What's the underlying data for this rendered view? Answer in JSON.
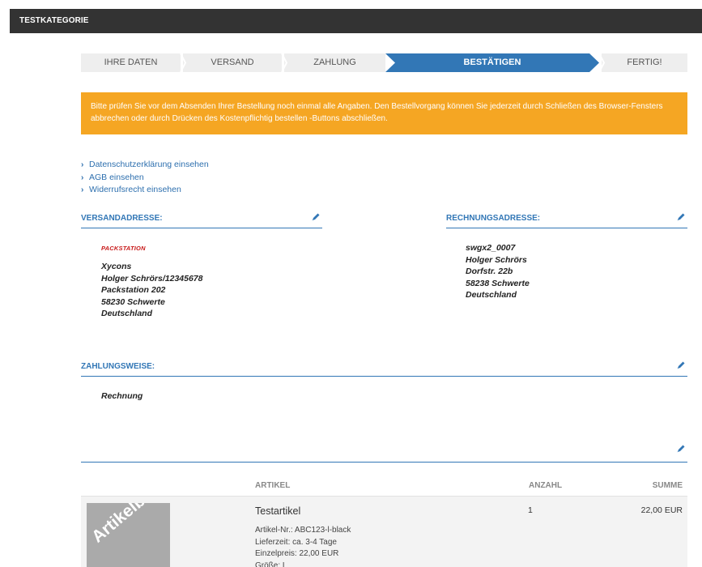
{
  "header": {
    "category": "TESTKATEGORIE"
  },
  "steps": [
    {
      "label": "IHRE DATEN",
      "active": false
    },
    {
      "label": "VERSAND",
      "active": false
    },
    {
      "label": "ZAHLUNG",
      "active": false
    },
    {
      "label": "BESTÄTIGEN",
      "active": true
    },
    {
      "label": "FERTIG!",
      "active": false
    }
  ],
  "notice": {
    "text": "Bitte prüfen Sie vor dem Absenden Ihrer Bestellung noch einmal alle Angaben. Den Bestellvorgang können Sie jederzeit durch Schließen des Browser-Fensters abbrechen oder durch Drücken des Kostenpflichtig bestellen -Buttons abschließen."
  },
  "links": [
    "Datenschutzerklärung einsehen",
    "AGB einsehen",
    "Widerrufsrecht einsehen"
  ],
  "shipping": {
    "title": "VERSANDADRESSE:",
    "brand": "PACKSTATION",
    "lines": [
      "Xycons",
      "Holger Schrörs/12345678",
      "Packstation 202",
      "58230 Schwerte",
      "Deutschland"
    ]
  },
  "billing": {
    "title": "RECHNUNGSADRESSE:",
    "lines": [
      "swgx2_0007",
      "Holger Schrörs",
      "Dorfstr. 22b",
      "58238 Schwerte",
      "Deutschland"
    ]
  },
  "payment": {
    "title": "ZAHLUNGSWEISE:",
    "method": "Rechnung"
  },
  "cart": {
    "headers": {
      "article": "ARTIKEL",
      "qty": "ANZAHL",
      "sum": "SUMME"
    },
    "items": [
      {
        "image_label": "Artikelbild",
        "name": "Testartikel",
        "article_no": "Artikel-Nr.: ABC123-l-black",
        "delivery": "Lieferzeit: ca. 3-4 Tage",
        "unit_price": "Einzelpreis: 22,00 EUR",
        "size": "Größe: L",
        "qty": "1",
        "sum": "22,00 EUR"
      }
    ]
  },
  "colors": {
    "accent": "#3277b6",
    "notice": "#f5a623",
    "topbar": "#333333"
  }
}
